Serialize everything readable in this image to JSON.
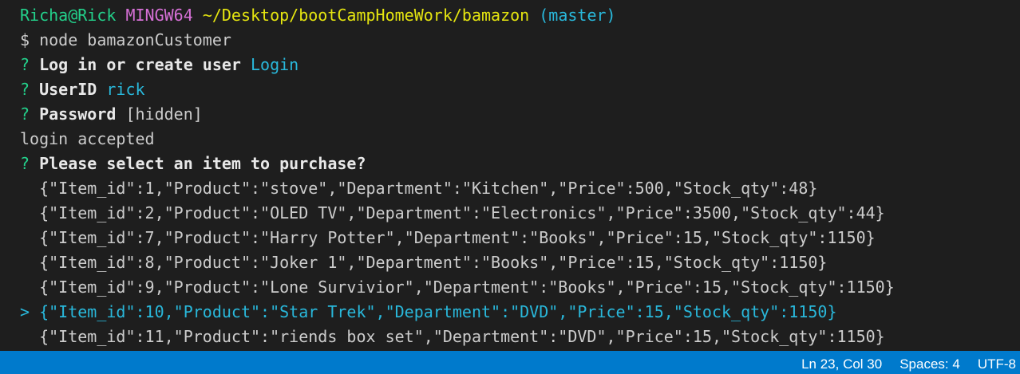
{
  "prompt": {
    "user_host": "Richa@Rick",
    "system": "MINGW64",
    "path": "~/Desktop/bootCampHomeWork/bamazon",
    "branch": "(master)"
  },
  "command": "$ node bamazonCustomer",
  "questions": {
    "q1_label": "Log in or create user",
    "q1_answer": "Login",
    "q2_label": "UserID",
    "q2_answer": "rick",
    "q3_label": "Password",
    "q3_answer": "[hidden]",
    "status": "login accepted",
    "q4_label": "Please select an item to purchase?"
  },
  "question_mark": "?",
  "pointer": ">",
  "choices": [
    "{\"Item_id\":1,\"Product\":\"stove\",\"Department\":\"Kitchen\",\"Price\":500,\"Stock_qty\":48}",
    "{\"Item_id\":2,\"Product\":\"OLED TV\",\"Department\":\"Electronics\",\"Price\":3500,\"Stock_qty\":44}",
    "{\"Item_id\":7,\"Product\":\"Harry Potter\",\"Department\":\"Books\",\"Price\":15,\"Stock_qty\":1150}",
    "{\"Item_id\":8,\"Product\":\"Joker 1\",\"Department\":\"Books\",\"Price\":15,\"Stock_qty\":1150}",
    "{\"Item_id\":9,\"Product\":\"Lone Survivior\",\"Department\":\"Books\",\"Price\":15,\"Stock_qty\":1150}",
    "{\"Item_id\":10,\"Product\":\"Star Trek\",\"Department\":\"DVD\",\"Price\":15,\"Stock_qty\":1150}",
    "{\"Item_id\":11,\"Product\":\"riends box set\",\"Department\":\"DVD\",\"Price\":15,\"Stock_qty\":1150}"
  ],
  "selected_index": 5,
  "statusbar": {
    "position": "Ln 23, Col 30",
    "spaces": "Spaces: 4",
    "encoding": "UTF-8"
  },
  "colors": {
    "background": "#1e1e1e",
    "prompt_green": "#23d18b",
    "prompt_magenta": "#d670d6",
    "path_yellow": "#e5e510",
    "answer_cyan": "#29b8db",
    "statusbar_blue": "#007acc"
  }
}
